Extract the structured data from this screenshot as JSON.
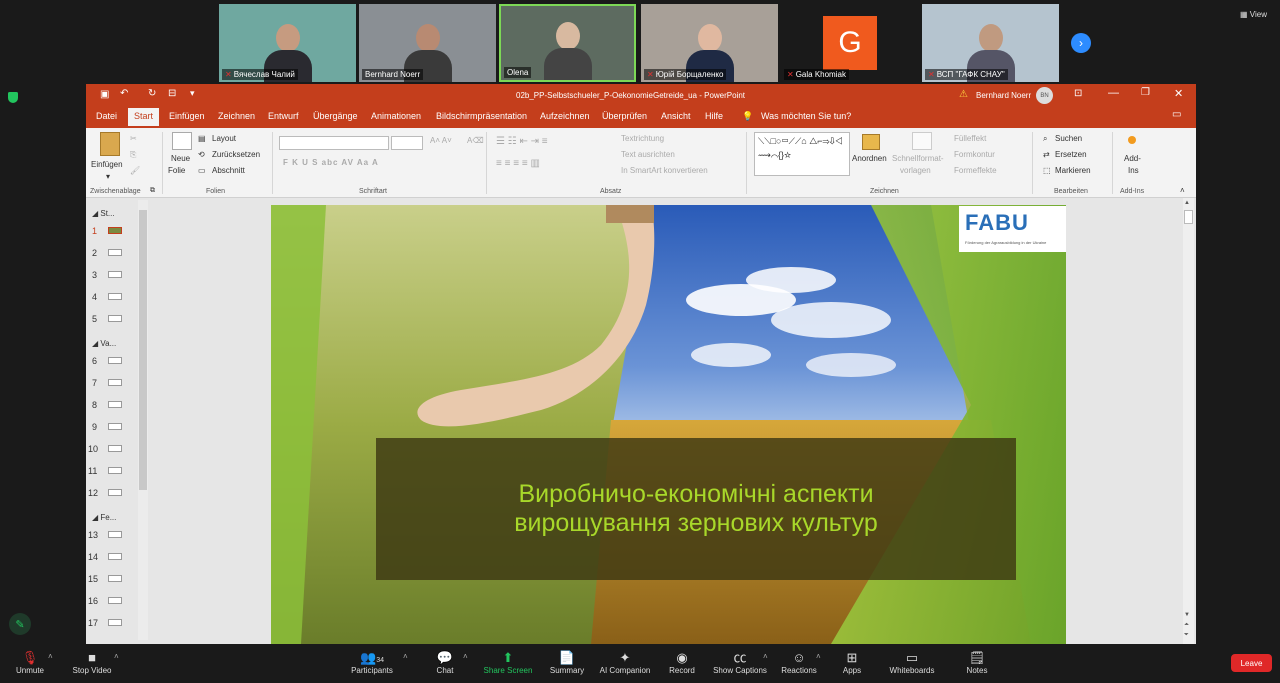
{
  "participants": [
    {
      "name": "Вячеслав Чалий",
      "muted": true
    },
    {
      "name": "Bernhard Noerr",
      "muted": false
    },
    {
      "name": "Olena",
      "muted": false
    },
    {
      "name": "Юрій Борщаленко",
      "muted": true
    },
    {
      "name": "Gala Khomiak",
      "muted": true,
      "initial": "G"
    },
    {
      "name": "ВСП \"ГАФК СНАУ\"",
      "muted": true
    }
  ],
  "view_label": "View",
  "ppt": {
    "filename": "02b_PP-Selbstschueler_P-OekonomieGetreide_ua  -  PowerPoint",
    "user": "Bernhard Noerr",
    "user_initials": "BN",
    "tabs": [
      "Datei",
      "Start",
      "Einfügen",
      "Zeichnen",
      "Entwurf",
      "Übergänge",
      "Animationen",
      "Bildschirmpräsentation",
      "Aufzeichnen",
      "Überprüfen",
      "Ansicht",
      "Hilfe"
    ],
    "tellme": "Was möchten Sie tun?",
    "ribbon": {
      "einfuegen": "Einfügen",
      "neue_folie_1": "Neue",
      "neue_folie_2": "Folie",
      "layout": "Layout",
      "zuruecksetzen": "Zurücksetzen",
      "abschnitt": "Abschnitt",
      "textrichtung": "Textrichtung",
      "text_ausrichten": "Text ausrichten",
      "smartart": "In SmartArt konvertieren",
      "anordnen": "Anordnen",
      "schnellformat_1": "Schnellformat-",
      "schnellformat_2": "vorlagen",
      "fuelleffekt": "Fülleffekt",
      "formkontur": "Formkontur",
      "formeffekte": "Formeffekte",
      "suchen": "Suchen",
      "ersetzen": "Ersetzen",
      "markieren": "Markieren",
      "addins_1": "Add-",
      "addins_2": "Ins",
      "font_tools": "F  K  U  S  abc  AV  Aa  A",
      "groups": {
        "zwischenablage": "Zwischenablage",
        "folien": "Folien",
        "schriftart": "Schriftart",
        "absatz": "Absatz",
        "zeichnen": "Zeichnen",
        "bearbeiten": "Bearbeiten",
        "addins": "Add-Ins"
      }
    },
    "sections": [
      "St...",
      "Va...",
      "Fe..."
    ],
    "thumbnails": [
      "1",
      "2",
      "3",
      "4",
      "5",
      "6",
      "7",
      "8",
      "9",
      "10",
      "11",
      "12",
      "13",
      "14",
      "15",
      "16",
      "17"
    ],
    "slide": {
      "title_line1": "Виробничо-економічні аспекти",
      "title_line2": "вирощування зернових культур",
      "logo_text": "FABU",
      "logo_subtitle": "Förderung der Agrarausbildung in der Ukraine"
    }
  },
  "toolbar": {
    "unmute": "Unmute",
    "stop_video": "Stop Video",
    "participants": "Participants",
    "participant_count": "34",
    "chat": "Chat",
    "share_screen": "Share Screen",
    "summary": "Summary",
    "ai_companion": "AI Companion",
    "record": "Record",
    "show_captions": "Show Captions",
    "reactions": "Reactions",
    "apps": "Apps",
    "whiteboards": "Whiteboards",
    "notes": "Notes",
    "leave": "Leave"
  },
  "colors": {
    "ppt_accent": "#c43e1c",
    "zoom_blue": "#2d8cff",
    "leave_red": "#e02828",
    "slide_title": "#a8d82a"
  }
}
